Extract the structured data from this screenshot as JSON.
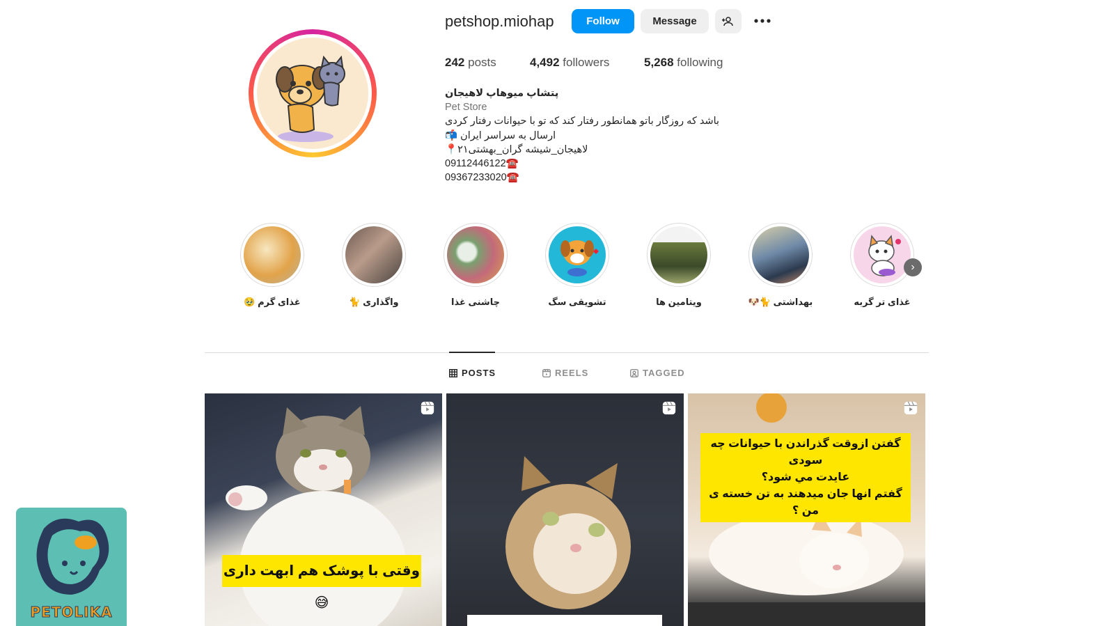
{
  "profile": {
    "username": "petshop.miohap",
    "follow_label": "Follow",
    "message_label": "Message",
    "stats": {
      "posts_count": "242",
      "posts_label": "posts",
      "followers_count": "4,492",
      "followers_label": "followers",
      "following_count": "5,268",
      "following_label": "following"
    },
    "bio": {
      "name": "پتشاپ میوهاپ لاهیجان",
      "category": "Pet Store",
      "line1": "باشد که روزگار باتو همانطور رفتار کند که تو با حیوانات رفتار کردی",
      "line2": "ارسال به سراسر ایران 📬",
      "line3": "لاهیجان_شیشه گران_بهشتی۲۱📍",
      "phone1": "09112446122☎️",
      "phone2": "09367233020☎️"
    }
  },
  "highlights": [
    {
      "label": "غذای گرم 🥹"
    },
    {
      "label": "واگذاری 🐈"
    },
    {
      "label": "چاشنی غذا"
    },
    {
      "label": "تشویقی سگ"
    },
    {
      "label": "ویتامین ها"
    },
    {
      "label": "بهداشتی 🐈🐶"
    },
    {
      "label": "غذای تر گربه"
    }
  ],
  "tabs": [
    {
      "label": "POSTS",
      "active": true
    },
    {
      "label": "REELS",
      "active": false
    },
    {
      "label": "TAGGED",
      "active": false
    }
  ],
  "posts": [
    {
      "caption": "وقتی با پوشک هم ابهت داری😅"
    },
    {
      "caption": ""
    },
    {
      "caption_line1": "گفتن ازوقت گذراندن  با حیوانات چه  سودی",
      "caption_line2": "عایدت مي شود؟",
      "caption_line3": "گفتم انها جان میدهند به تن خسته ی من ؟"
    }
  ],
  "watermark": {
    "brand": "PETOLIKA"
  },
  "colors": {
    "accent": "#0095f6",
    "text": "#262626",
    "muted": "#8e8e8e",
    "caption_bg": "#ffe600",
    "logo_bg": "#5dbfb3"
  }
}
